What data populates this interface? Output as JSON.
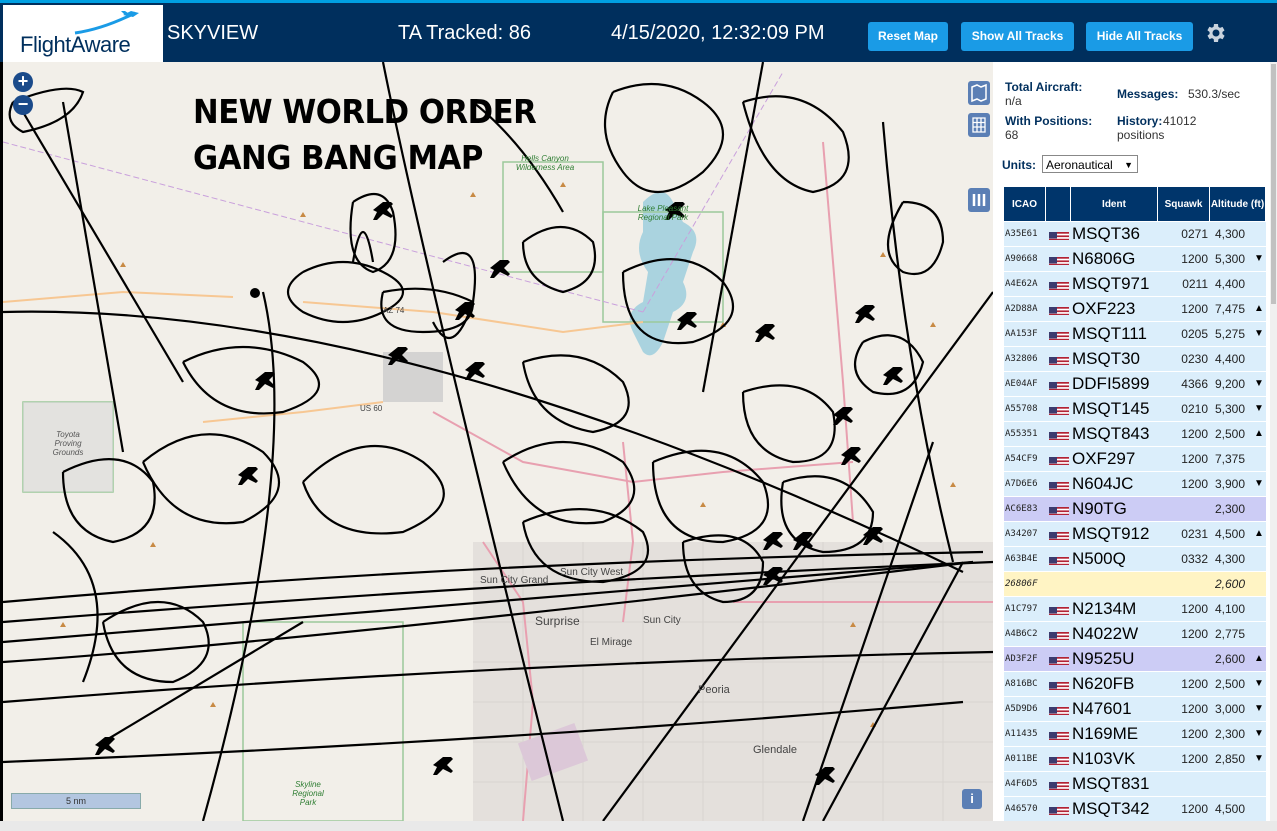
{
  "header": {
    "logo_text": "FlightAware",
    "app_name": "SKYVIEW",
    "tracked": "TA Tracked: 86",
    "datetime": "4/15/2020, 12:32:09 PM",
    "buttons": {
      "reset": "Reset Map",
      "show_all": "Show All Tracks",
      "hide_all": "Hide All Tracks"
    },
    "settings_icon": "gear-icon"
  },
  "map": {
    "title_line1": "NEW WORLD ORDER",
    "title_line2": "GANG BANG MAP",
    "zoom_in": "+",
    "zoom_out": "−",
    "scale_label": "5 nm",
    "info_label": "i",
    "labels": {
      "sun_city_grand": "Sun City Grand",
      "sun_city_west": "Sun City West",
      "surprise": "Surprise",
      "sun_city": "Sun City",
      "el_mirage": "El Mirage",
      "peoria": "Peoria",
      "glendale": "Glendale",
      "hells_canyon": "Hells Canyon Wilderness Area",
      "lake_pleasant": "Lake Pleasant Regional Park",
      "toyota": "Toyota Proving Grounds",
      "skyline": "Skyline Regional Park",
      "az74": "AZ 74",
      "us60": "US 60"
    }
  },
  "panel": {
    "total_aircraft_label": "Total Aircraft:",
    "total_aircraft_value": "n/a",
    "messages_label": "Messages:",
    "messages_value": "530.3/sec",
    "with_positions_label": "With Positions:",
    "with_positions_value": "68",
    "history_label": "History:",
    "history_value": "41012 positions",
    "units_label": "Units:",
    "units_value": "Aeronautical",
    "columns": {
      "icao": "ICAO",
      "ident": "Ident",
      "squawk": "Squawk",
      "altitude": "Altitude (ft)"
    },
    "rows": [
      {
        "icao": "A35E61",
        "flag": true,
        "ident": "MSQT36",
        "squawk": "0271",
        "alt": "4,300",
        "trend": "",
        "bg": "#dbeefb"
      },
      {
        "icao": "A90668",
        "flag": true,
        "ident": "N6806G",
        "squawk": "1200",
        "alt": "5,300",
        "trend": "▼",
        "bg": "#dbeefb"
      },
      {
        "icao": "A4E62A",
        "flag": true,
        "ident": "MSQT971",
        "squawk": "0211",
        "alt": "4,400",
        "trend": "",
        "bg": "#dbeefb"
      },
      {
        "icao": "A2D88A",
        "flag": true,
        "ident": "OXF223",
        "squawk": "1200",
        "alt": "7,475",
        "trend": "▲",
        "bg": "#dbeefb"
      },
      {
        "icao": "AA153F",
        "flag": true,
        "ident": "MSQT111",
        "squawk": "0205",
        "alt": "5,275",
        "trend": "▼",
        "bg": "#dbeefb"
      },
      {
        "icao": "A32806",
        "flag": true,
        "ident": "MSQT30",
        "squawk": "0230",
        "alt": "4,400",
        "trend": "",
        "bg": "#dbeefb"
      },
      {
        "icao": "AE04AF",
        "flag": true,
        "ident": "DDFI5899",
        "squawk": "4366",
        "alt": "9,200",
        "trend": "▼",
        "bg": "#dbeefb"
      },
      {
        "icao": "A55708",
        "flag": true,
        "ident": "MSQT145",
        "squawk": "0210",
        "alt": "5,300",
        "trend": "▼",
        "bg": "#dbeefb"
      },
      {
        "icao": "A55351",
        "flag": true,
        "ident": "MSQT843",
        "squawk": "1200",
        "alt": "2,500",
        "trend": "▲",
        "bg": "#dbeefb"
      },
      {
        "icao": "A54CF9",
        "flag": true,
        "ident": "OXF297",
        "squawk": "1200",
        "alt": "7,375",
        "trend": "",
        "bg": "#dbeefb"
      },
      {
        "icao": "A7D6E6",
        "flag": true,
        "ident": "N604JC",
        "squawk": "1200",
        "alt": "3,900",
        "trend": "▼",
        "bg": "#dbeefb"
      },
      {
        "icao": "AC6E83",
        "flag": true,
        "ident": "N90TG",
        "squawk": "",
        "alt": "2,300",
        "trend": "",
        "bg": "#ccccf5"
      },
      {
        "icao": "A34207",
        "flag": true,
        "ident": "MSQT912",
        "squawk": "0231",
        "alt": "4,500",
        "trend": "▲",
        "bg": "#dbeefb"
      },
      {
        "icao": "A63B4E",
        "flag": true,
        "ident": "N500Q",
        "squawk": "0332",
        "alt": "4,300",
        "trend": "",
        "bg": "#dbeefb"
      },
      {
        "icao": "26806F",
        "flag": false,
        "ident": "",
        "squawk": "",
        "alt": "2,600",
        "trend": "",
        "bg": "#fff4c4"
      },
      {
        "icao": "A1C797",
        "flag": true,
        "ident": "N2134M",
        "squawk": "1200",
        "alt": "4,100",
        "trend": "",
        "bg": "#dbeefb"
      },
      {
        "icao": "A4B6C2",
        "flag": true,
        "ident": "N4022W",
        "squawk": "1200",
        "alt": "2,775",
        "trend": "",
        "bg": "#dbeefb"
      },
      {
        "icao": "AD3F2F",
        "flag": true,
        "ident": "N9525U",
        "squawk": "",
        "alt": "2,600",
        "trend": "▲",
        "bg": "#ccccf5"
      },
      {
        "icao": "A816BC",
        "flag": true,
        "ident": "N620FB",
        "squawk": "1200",
        "alt": "2,500",
        "trend": "▼",
        "bg": "#dbeefb"
      },
      {
        "icao": "A5D9D6",
        "flag": true,
        "ident": "N47601",
        "squawk": "1200",
        "alt": "3,000",
        "trend": "▼",
        "bg": "#dbeefb"
      },
      {
        "icao": "A11435",
        "flag": true,
        "ident": "N169ME",
        "squawk": "1200",
        "alt": "2,300",
        "trend": "▼",
        "bg": "#dbeefb"
      },
      {
        "icao": "A011BE",
        "flag": true,
        "ident": "N103VK",
        "squawk": "1200",
        "alt": "2,850",
        "trend": "▼",
        "bg": "#dbeefb"
      },
      {
        "icao": "A4F6D5",
        "flag": true,
        "ident": "MSQT831",
        "squawk": "",
        "alt": "",
        "trend": "",
        "bg": "#dbeefb"
      },
      {
        "icao": "A46570",
        "flag": true,
        "ident": "MSQT342",
        "squawk": "1200",
        "alt": "4,500",
        "trend": "",
        "bg": "#dbeefb"
      }
    ]
  }
}
